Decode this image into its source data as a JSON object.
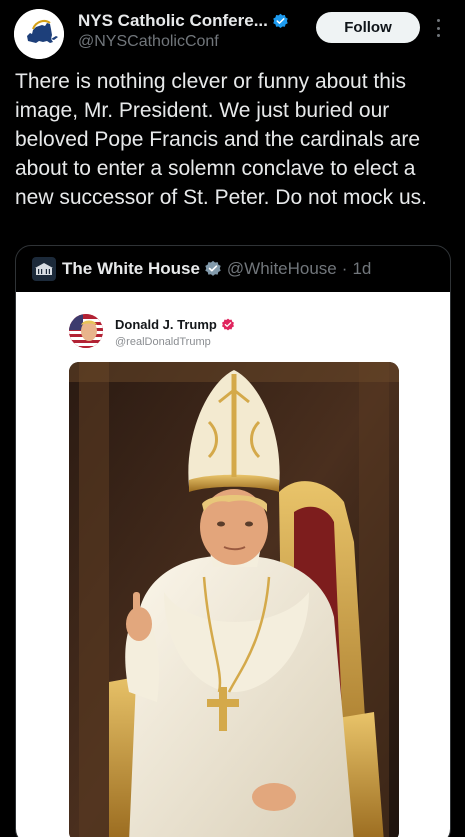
{
  "tweet": {
    "author": {
      "display_name": "NYS Catholic Confere...",
      "handle": "@NYSCatholicConf"
    },
    "follow_label": "Follow",
    "text": "There is nothing clever or funny about this image, Mr. President. We just buried our beloved Pope Francis and the cardinals are about to enter a solemn conclave to elect a new successor of St. Peter. Do not mock us."
  },
  "quote": {
    "author_name": "The White House",
    "author_handle": "@WhiteHouse",
    "separator": "·",
    "age": "1d",
    "inner_post": {
      "author_name": "Donald J. Trump",
      "author_handle": "@realDonaldTrump",
      "image_alt": "AI-generated image of Trump dressed as the pope"
    }
  },
  "colors": {
    "background": "#000000",
    "text_primary": "#e7e9ea",
    "text_secondary": "#71767b",
    "verified_blue": "#1d9bf0",
    "verified_gray": "#829aab",
    "trump_badge_red": "#e0245e",
    "follow_bg": "#eff3f4"
  },
  "icons": {
    "verified": "verified-badge-icon",
    "government": "government-badge-icon",
    "more": "more-options-icon"
  }
}
